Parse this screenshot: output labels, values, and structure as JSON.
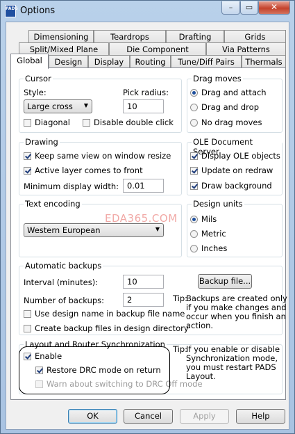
{
  "window": {
    "title": "Options",
    "app_icon_text": "PADS",
    "minimize_glyph": "–",
    "maximize_glyph": "▭",
    "close_glyph": "✕"
  },
  "tabs": {
    "row1": [
      "Dimensioning",
      "Teardrops",
      "Drafting",
      "Grids"
    ],
    "row2": [
      "Split/Mixed Plane",
      "Die Component",
      "Via Patterns"
    ],
    "row3": [
      "Global",
      "Design",
      "Display",
      "Routing",
      "Tune/Diff Pairs",
      "Thermals"
    ],
    "active": "Global"
  },
  "cursor": {
    "title": "Cursor",
    "style_label": "Style:",
    "style_value": "Large cross",
    "pick_radius_label": "Pick radius:",
    "pick_radius_value": "10",
    "diagonal_label": "Diagonal",
    "diagonal_checked": false,
    "disable_double_click_label": "Disable double click",
    "disable_double_click_checked": false
  },
  "drag_moves": {
    "title": "Drag moves",
    "options": [
      "Drag and attach",
      "Drag and drop",
      "No drag moves"
    ],
    "selected": "Drag and attach"
  },
  "drawing": {
    "title": "Drawing",
    "keep_same_view_label": "Keep same view on window resize",
    "keep_same_view_checked": true,
    "active_layer_front_label": "Active layer comes to front",
    "active_layer_front_checked": true,
    "min_display_width_label": "Minimum display width:",
    "min_display_width_value": "0.01"
  },
  "ole": {
    "title": "OLE Document Server",
    "display_ole_label": "Display OLE objects",
    "display_ole_checked": true,
    "update_redraw_label": "Update on redraw",
    "update_redraw_checked": true,
    "draw_background_label": "Draw background",
    "draw_background_checked": true
  },
  "text_encoding": {
    "title": "Text encoding",
    "value": "Western European"
  },
  "design_units": {
    "title": "Design units",
    "options": [
      "Mils",
      "Metric",
      "Inches"
    ],
    "selected": "Mils"
  },
  "backups": {
    "title": "Automatic backups",
    "interval_label": "Interval (minutes):",
    "interval_value": "10",
    "number_label": "Number of backups:",
    "number_value": "2",
    "backup_file_button": "Backup file...",
    "use_design_name_label": "Use design name in backup file name",
    "use_design_name_checked": false,
    "create_in_design_dir_label": "Create backup files in design directory",
    "create_in_design_dir_checked": false,
    "tip_prefix": "Tip:",
    "tip_lines": [
      "Backups are created only",
      "if you make changes and",
      "occur when you finish an",
      "action."
    ]
  },
  "sync": {
    "title": "Layout and Router Synchronization",
    "enable_label": "Enable",
    "enable_checked": true,
    "restore_drc_label": "Restore DRC mode on return",
    "restore_drc_checked": true,
    "warn_drc_off_label": "Warn about switching to DRC Off mode",
    "warn_drc_off_checked": false,
    "tip_prefix": "Tip:",
    "tip_lines": [
      "If you enable or disable",
      "Synchronization mode,",
      "you must restart PADS",
      "Layout."
    ]
  },
  "buttons": {
    "ok": "OK",
    "cancel": "Cancel",
    "apply": "Apply",
    "help": "Help"
  },
  "watermark": "EDA365.COM"
}
